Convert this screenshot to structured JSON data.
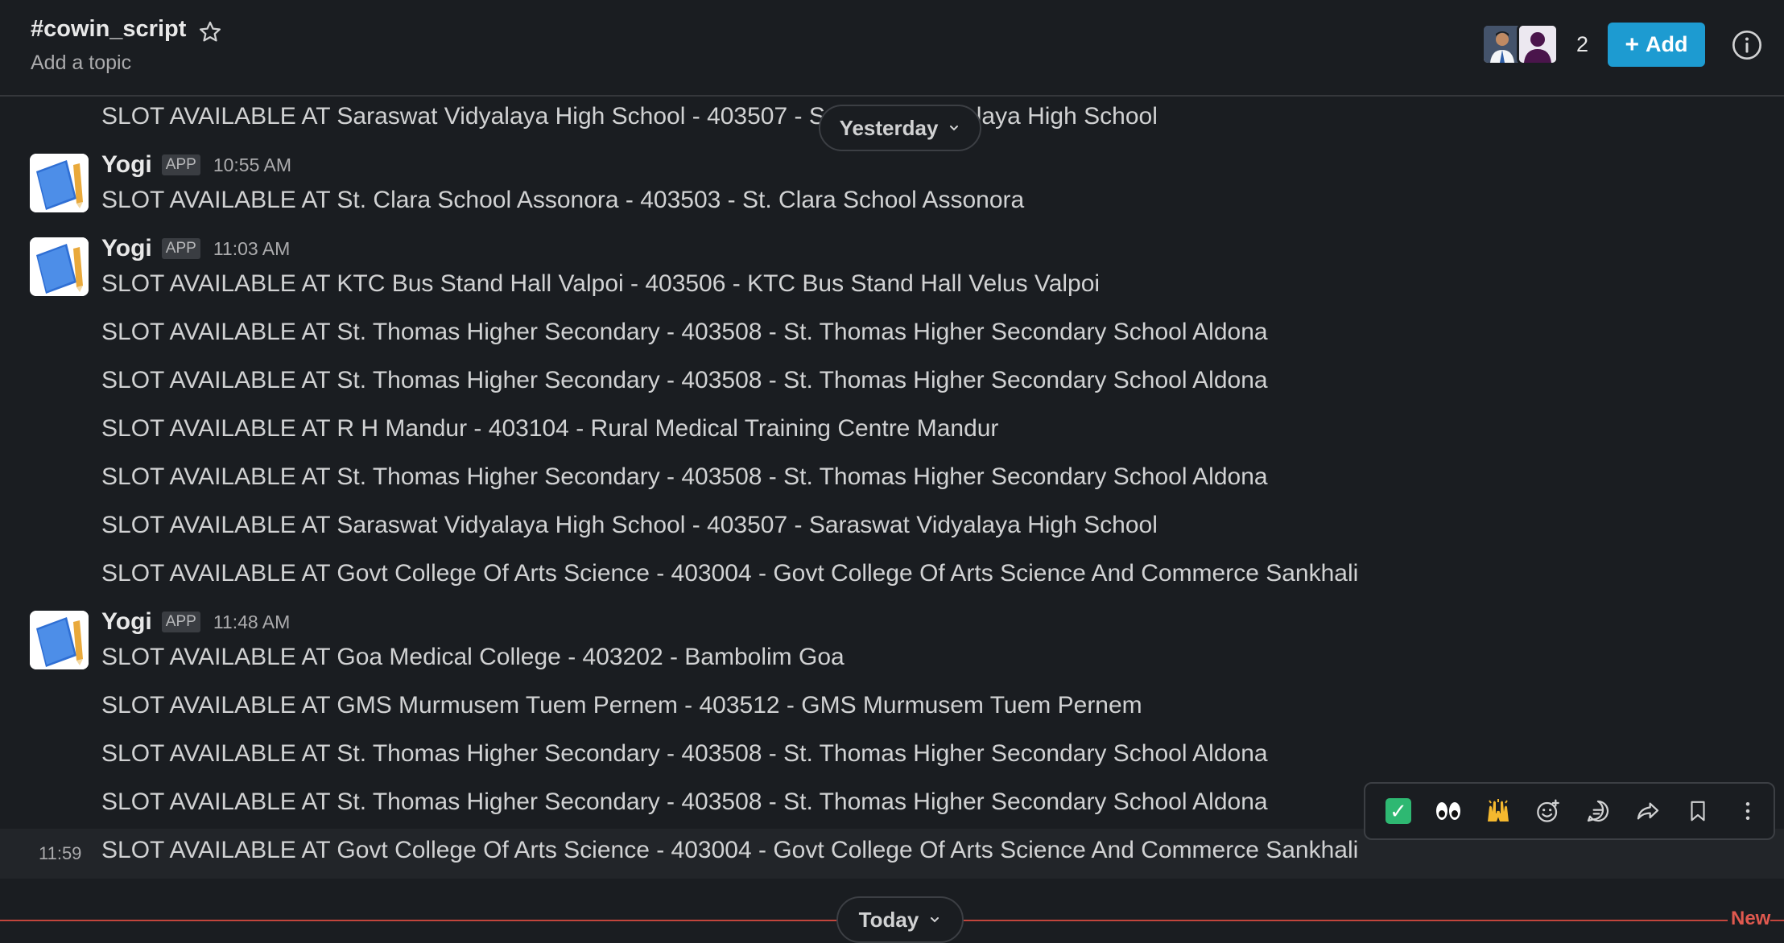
{
  "header": {
    "channel_name": "#cowin_script",
    "topic_placeholder": "Add a topic",
    "member_count": "2",
    "add_label": "Add"
  },
  "date_pills": {
    "yesterday": "Yesterday",
    "today": "Today"
  },
  "new_divider_label": "New",
  "messages": {
    "top_partial": "SLOT AVAILABLE AT Saraswat Vidyalaya High School - 403507 - Saraswat Vidyalaya High School",
    "groups": [
      {
        "sender": "Yogi",
        "badge": "APP",
        "time": "10:55 AM",
        "lines": [
          "SLOT AVAILABLE AT St. Clara School Assonora - 403503 - St. Clara School Assonora"
        ]
      },
      {
        "sender": "Yogi",
        "badge": "APP",
        "time": "11:03 AM",
        "lines": [
          "SLOT AVAILABLE AT KTC Bus Stand Hall Valpoi - 403506 - KTC Bus Stand Hall Velus Valpoi",
          "SLOT AVAILABLE AT St. Thomas Higher Secondary - 403508 - St. Thomas Higher Secondary School Aldona",
          "SLOT AVAILABLE AT St. Thomas Higher Secondary - 403508 - St. Thomas Higher Secondary School Aldona",
          "SLOT AVAILABLE AT R H Mandur - 403104 - Rural Medical Training Centre Mandur",
          "SLOT AVAILABLE AT St. Thomas Higher Secondary - 403508 - St. Thomas Higher Secondary School Aldona",
          "SLOT AVAILABLE AT Saraswat Vidyalaya High School - 403507 - Saraswat Vidyalaya High School",
          "SLOT AVAILABLE AT Govt College Of Arts Science - 403004 - Govt College Of Arts Science And Commerce Sankhali"
        ]
      },
      {
        "sender": "Yogi",
        "badge": "APP",
        "time": "11:48 AM",
        "lines": [
          "SLOT AVAILABLE AT Goa Medical College - 403202 - Bambolim Goa",
          "SLOT AVAILABLE AT GMS Murmusem Tuem Pernem - 403512 - GMS Murmusem Tuem Pernem",
          "SLOT AVAILABLE AT St. Thomas Higher Secondary - 403508 - St. Thomas Higher Secondary School Aldona",
          "SLOT AVAILABLE AT St. Thomas Higher Secondary - 403508 - St. Thomas Higher Secondary School Aldona",
          "SLOT AVAILABLE AT Govt College Of Arts Science - 403004 - Govt College Of Arts Science And Commerce Sankhali"
        ],
        "hover_time": "11:59"
      }
    ]
  },
  "toolbar": {
    "icons": [
      "white-check-mark-emoji",
      "eyes-emoji",
      "raised-hands-emoji",
      "add-reaction-icon",
      "reply-in-thread-icon",
      "share-icon",
      "bookmark-icon",
      "more-actions-icon"
    ]
  },
  "colors": {
    "background": "#1a1d21",
    "accent": "#1d9bd1",
    "new_divider": "#c2453c"
  }
}
